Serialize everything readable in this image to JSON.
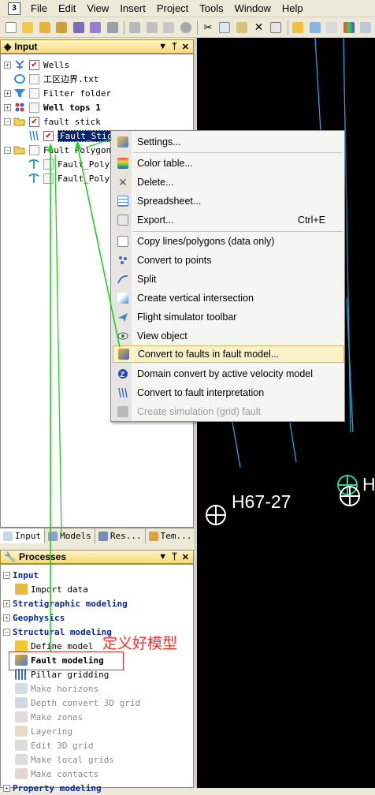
{
  "menubar": {
    "items": [
      "File",
      "Edit",
      "View",
      "Insert",
      "Project",
      "Tools",
      "Window",
      "Help"
    ]
  },
  "input_panel": {
    "title": "Input",
    "tree": [
      {
        "label": "Wells",
        "checked": true,
        "icon": "wells-icon"
      },
      {
        "label": "工区边界.txt",
        "checked": false,
        "icon": "boundary-icon"
      },
      {
        "label": "Filter folder",
        "checked": false,
        "icon": "filter-folder-icon"
      },
      {
        "label": "Well tops 1",
        "checked": false,
        "icon": "well-tops-icon"
      },
      {
        "label": "fault stick",
        "checked": true,
        "icon": "folder-icon"
      },
      {
        "label": "Fault_Stick",
        "checked": true,
        "icon": "fault-stick-icon"
      },
      {
        "label": "Fault Polygon",
        "checked": false,
        "icon": "folder-icon"
      },
      {
        "label": "Fault_Polys",
        "checked": false,
        "icon": "fault-polygon-icon"
      },
      {
        "label": "Fault_Polys",
        "checked": false,
        "icon": "fault-polygon-icon"
      }
    ]
  },
  "tabs": [
    "Input",
    "Models",
    "Res...",
    "Tem..."
  ],
  "processes_panel": {
    "title": "Processes",
    "items": [
      {
        "label": "Input",
        "type": "group"
      },
      {
        "label": "Import data",
        "type": "item"
      },
      {
        "label": "Stratigraphic modeling",
        "type": "group"
      },
      {
        "label": "Geophysics",
        "type": "group"
      },
      {
        "label": "Structural modeling",
        "type": "group"
      },
      {
        "label": "Define model",
        "type": "item"
      },
      {
        "label": "Fault modeling",
        "type": "item-bold"
      },
      {
        "label": "Pillar gridding",
        "type": "item"
      },
      {
        "label": "Make horizons",
        "type": "disabled"
      },
      {
        "label": "Depth convert 3D grid",
        "type": "disabled"
      },
      {
        "label": "Make zones",
        "type": "disabled"
      },
      {
        "label": "Layering",
        "type": "disabled"
      },
      {
        "label": "Edit 3D grid",
        "type": "disabled"
      },
      {
        "label": "Make local grids",
        "type": "disabled"
      },
      {
        "label": "Make contacts",
        "type": "disabled"
      },
      {
        "label": "Property modeling",
        "type": "group"
      }
    ]
  },
  "annotation": {
    "text": "定义好模型",
    "color": "#ff2a2a"
  },
  "context_menu": {
    "items": [
      {
        "label": "Settings...",
        "icon": "settings-icon"
      },
      {
        "label": "Color table...",
        "icon": "color-table-icon"
      },
      {
        "label": "Delete...",
        "icon": "delete-icon"
      },
      {
        "label": "Spreadsheet...",
        "icon": "spreadsheet-icon"
      },
      {
        "label": "Export...",
        "shortcut": "Ctrl+E",
        "icon": "export-icon"
      },
      {
        "label": "Copy lines/polygons (data only)",
        "icon": "copy-icon"
      },
      {
        "label": "Convert to points",
        "icon": "points-icon"
      },
      {
        "label": "Split",
        "icon": "split-icon"
      },
      {
        "label": "Create vertical intersection",
        "icon": "intersection-icon"
      },
      {
        "label": "Flight simulator toolbar",
        "icon": "flight-icon"
      },
      {
        "label": "View object",
        "icon": "eye-icon"
      },
      {
        "label": "Convert to faults in fault model...",
        "icon": "convert-faults-icon",
        "highlighted": true
      },
      {
        "label": "Domain convert by active velocity model",
        "icon": "domain-convert-icon"
      },
      {
        "label": "Convert to fault interpretation",
        "icon": "fault-interp-icon"
      },
      {
        "label": "Create simulation (grid) fault",
        "icon": "sim-fault-icon",
        "disabled": true
      }
    ]
  },
  "viewport": {
    "well_labels": [
      "H67-27",
      "H"
    ]
  }
}
